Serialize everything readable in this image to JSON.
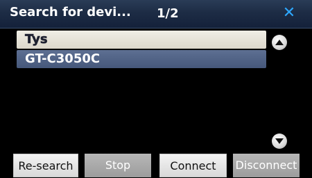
{
  "title_bar": {
    "title": "Search for devi...",
    "page_indicator": "1/2",
    "close_icon": "close-icon"
  },
  "device_list": {
    "items": [
      {
        "label": "Tys",
        "selected": true
      },
      {
        "label": "GT-C3050C",
        "selected": false
      }
    ]
  },
  "scroll": {
    "up_icon": "triangle-up-icon",
    "down_icon": "triangle-down-icon"
  },
  "buttons": {
    "research_label": "Re-search",
    "stop_label": "Stop",
    "connect_label": "Connect",
    "disconnect_label": "Disconnect"
  },
  "colors": {
    "accent": "#2ea8ff",
    "title_bar": "#1d2c45",
    "list_item": "#46587b",
    "list_item_selected": "#dcd7ca"
  }
}
